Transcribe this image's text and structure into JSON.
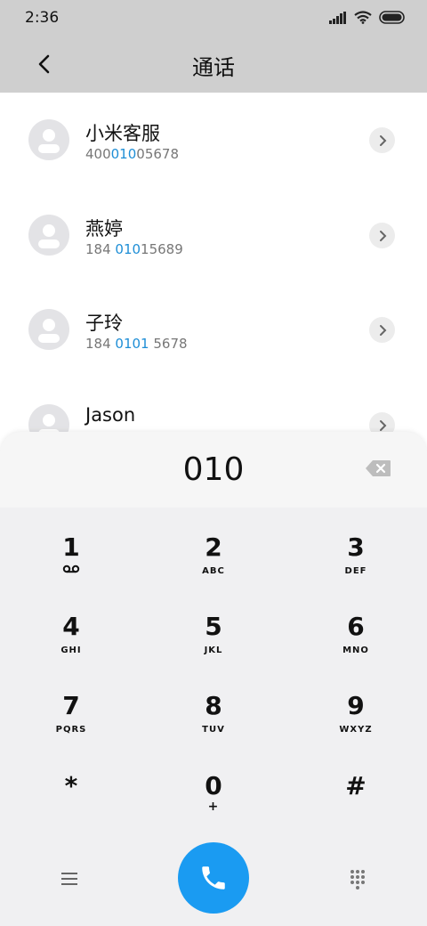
{
  "status": {
    "time": "2:36"
  },
  "appbar": {
    "title": "通话"
  },
  "contacts": [
    {
      "name": "小米客服",
      "num_pre": "400",
      "num_hl": "010",
      "num_post": "05678"
    },
    {
      "name": "燕婷",
      "num_pre": "184 ",
      "num_hl": "010",
      "num_post": "15689"
    },
    {
      "name": "子玲",
      "num_pre": "184 ",
      "num_hl": "0101",
      "num_post": " 5678"
    },
    {
      "name": "Jason",
      "num_pre": "",
      "num_hl": "",
      "num_post": ""
    }
  ],
  "dialer": {
    "number": "010",
    "keys": [
      {
        "digit": "1",
        "letters": ""
      },
      {
        "digit": "2",
        "letters": "ABC"
      },
      {
        "digit": "3",
        "letters": "DEF"
      },
      {
        "digit": "4",
        "letters": "GHI"
      },
      {
        "digit": "5",
        "letters": "JKL"
      },
      {
        "digit": "6",
        "letters": "MNO"
      },
      {
        "digit": "7",
        "letters": "PQRS"
      },
      {
        "digit": "8",
        "letters": "TUV"
      },
      {
        "digit": "9",
        "letters": "WXYZ"
      },
      {
        "digit": "*",
        "letters": ""
      },
      {
        "digit": "0",
        "letters": "+"
      },
      {
        "digit": "#",
        "letters": ""
      }
    ]
  },
  "colors": {
    "accent": "#1a9bf2",
    "highlight": "#1e8ed6",
    "header": "#cfcfcf"
  }
}
